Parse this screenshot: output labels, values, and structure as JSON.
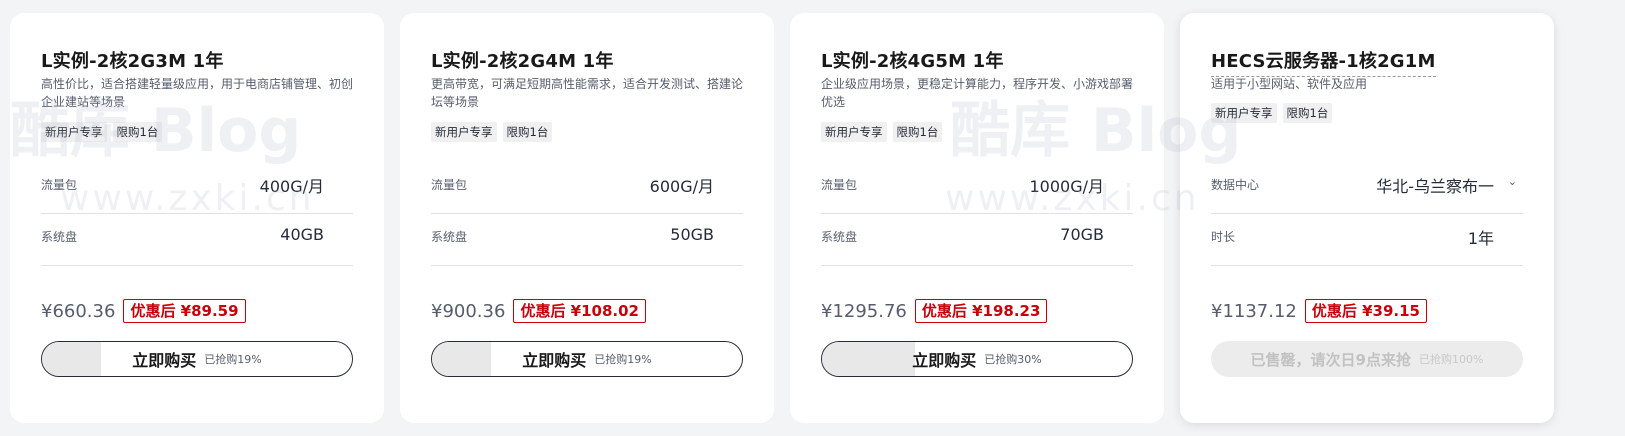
{
  "watermark": {
    "logo_text": "酷库 Blog",
    "url_text": "www.zxki.cn"
  },
  "cards": [
    {
      "title": "L实例-2核2G3M 1年",
      "desc": "高性价比，适合搭建轻量级应用，用于电商店铺管理、初创企业建站等场景",
      "tags": [
        "新用户专享",
        "限购1台"
      ],
      "rows": [
        {
          "label": "流量包",
          "value": "400G/月"
        },
        {
          "label": "系统盘",
          "value": "40GB"
        }
      ],
      "orig_price": "¥660.36",
      "discount_price": "优惠后 ¥89.59",
      "buy_label": "立即购买",
      "progress_text": "已抢购19%",
      "progress": 0.19
    },
    {
      "title": "L实例-2核2G4M 1年",
      "desc": "更高带宽，可满足短期高性能需求，适合开发测试、搭建论坛等场景",
      "tags": [
        "新用户专享",
        "限购1台"
      ],
      "rows": [
        {
          "label": "流量包",
          "value": "600G/月"
        },
        {
          "label": "系统盘",
          "value": "50GB"
        }
      ],
      "orig_price": "¥900.36",
      "discount_price": "优惠后 ¥108.02",
      "buy_label": "立即购买",
      "progress_text": "已抢购19%",
      "progress": 0.19
    },
    {
      "title": "L实例-2核4G5M 1年",
      "desc": "企业级应用场景，更稳定计算能力，程序开发、小游戏部署优选",
      "tags": [
        "新用户专享",
        "限购1台"
      ],
      "rows": [
        {
          "label": "流量包",
          "value": "1000G/月"
        },
        {
          "label": "系统盘",
          "value": "70GB"
        }
      ],
      "orig_price": "¥1295.76",
      "discount_price": "优惠后 ¥198.23",
      "buy_label": "立即购买",
      "progress_text": "已抢购30%",
      "progress": 0.3
    },
    {
      "title": "HECS云服务器-1核2G1M",
      "desc": "适用于小型网站、软件及应用",
      "tags": [
        "新用户专享",
        "限购1台"
      ],
      "rows": [
        {
          "label": "数据中心",
          "value": "华北-乌兰察布一"
        },
        {
          "label": "时长",
          "value": "1年"
        }
      ],
      "orig_price": "¥1137.12",
      "discount_price": "优惠后 ¥39.15",
      "buy_label": "已售罄，请次日9点来抢",
      "progress_text": "已抢购100%",
      "progress": 1.0
    }
  ]
}
